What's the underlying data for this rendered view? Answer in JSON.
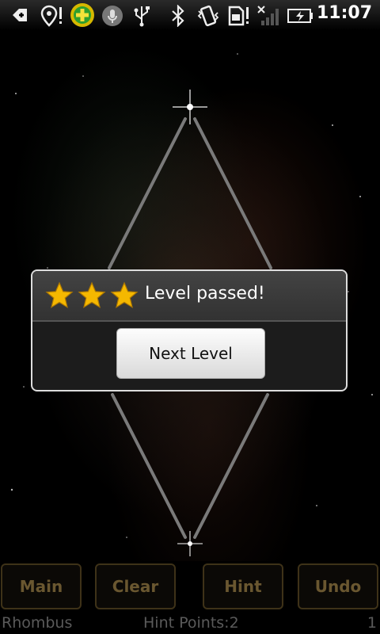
{
  "status_bar": {
    "time": "11:07",
    "icons": [
      "usb-debug-icon",
      "location-icon",
      "plus-app-icon",
      "mic-icon",
      "usb-icon",
      "bluetooth-icon",
      "vibrate-icon",
      "sim-icon",
      "signal-icon",
      "battery-charging-icon"
    ]
  },
  "dialog": {
    "title": "Level passed!",
    "stars": 3,
    "next_button": "Next Level"
  },
  "buttons": {
    "main": "Main",
    "clear": "Clear",
    "hint": "Hint",
    "undo": "Undo"
  },
  "footer": {
    "level_name": "Rhombus",
    "hint_points": "Hint Points:2",
    "count": "1"
  },
  "colors": {
    "button_text": "#6a5730",
    "button_border": "#3e3218",
    "star": "#f5b800"
  }
}
